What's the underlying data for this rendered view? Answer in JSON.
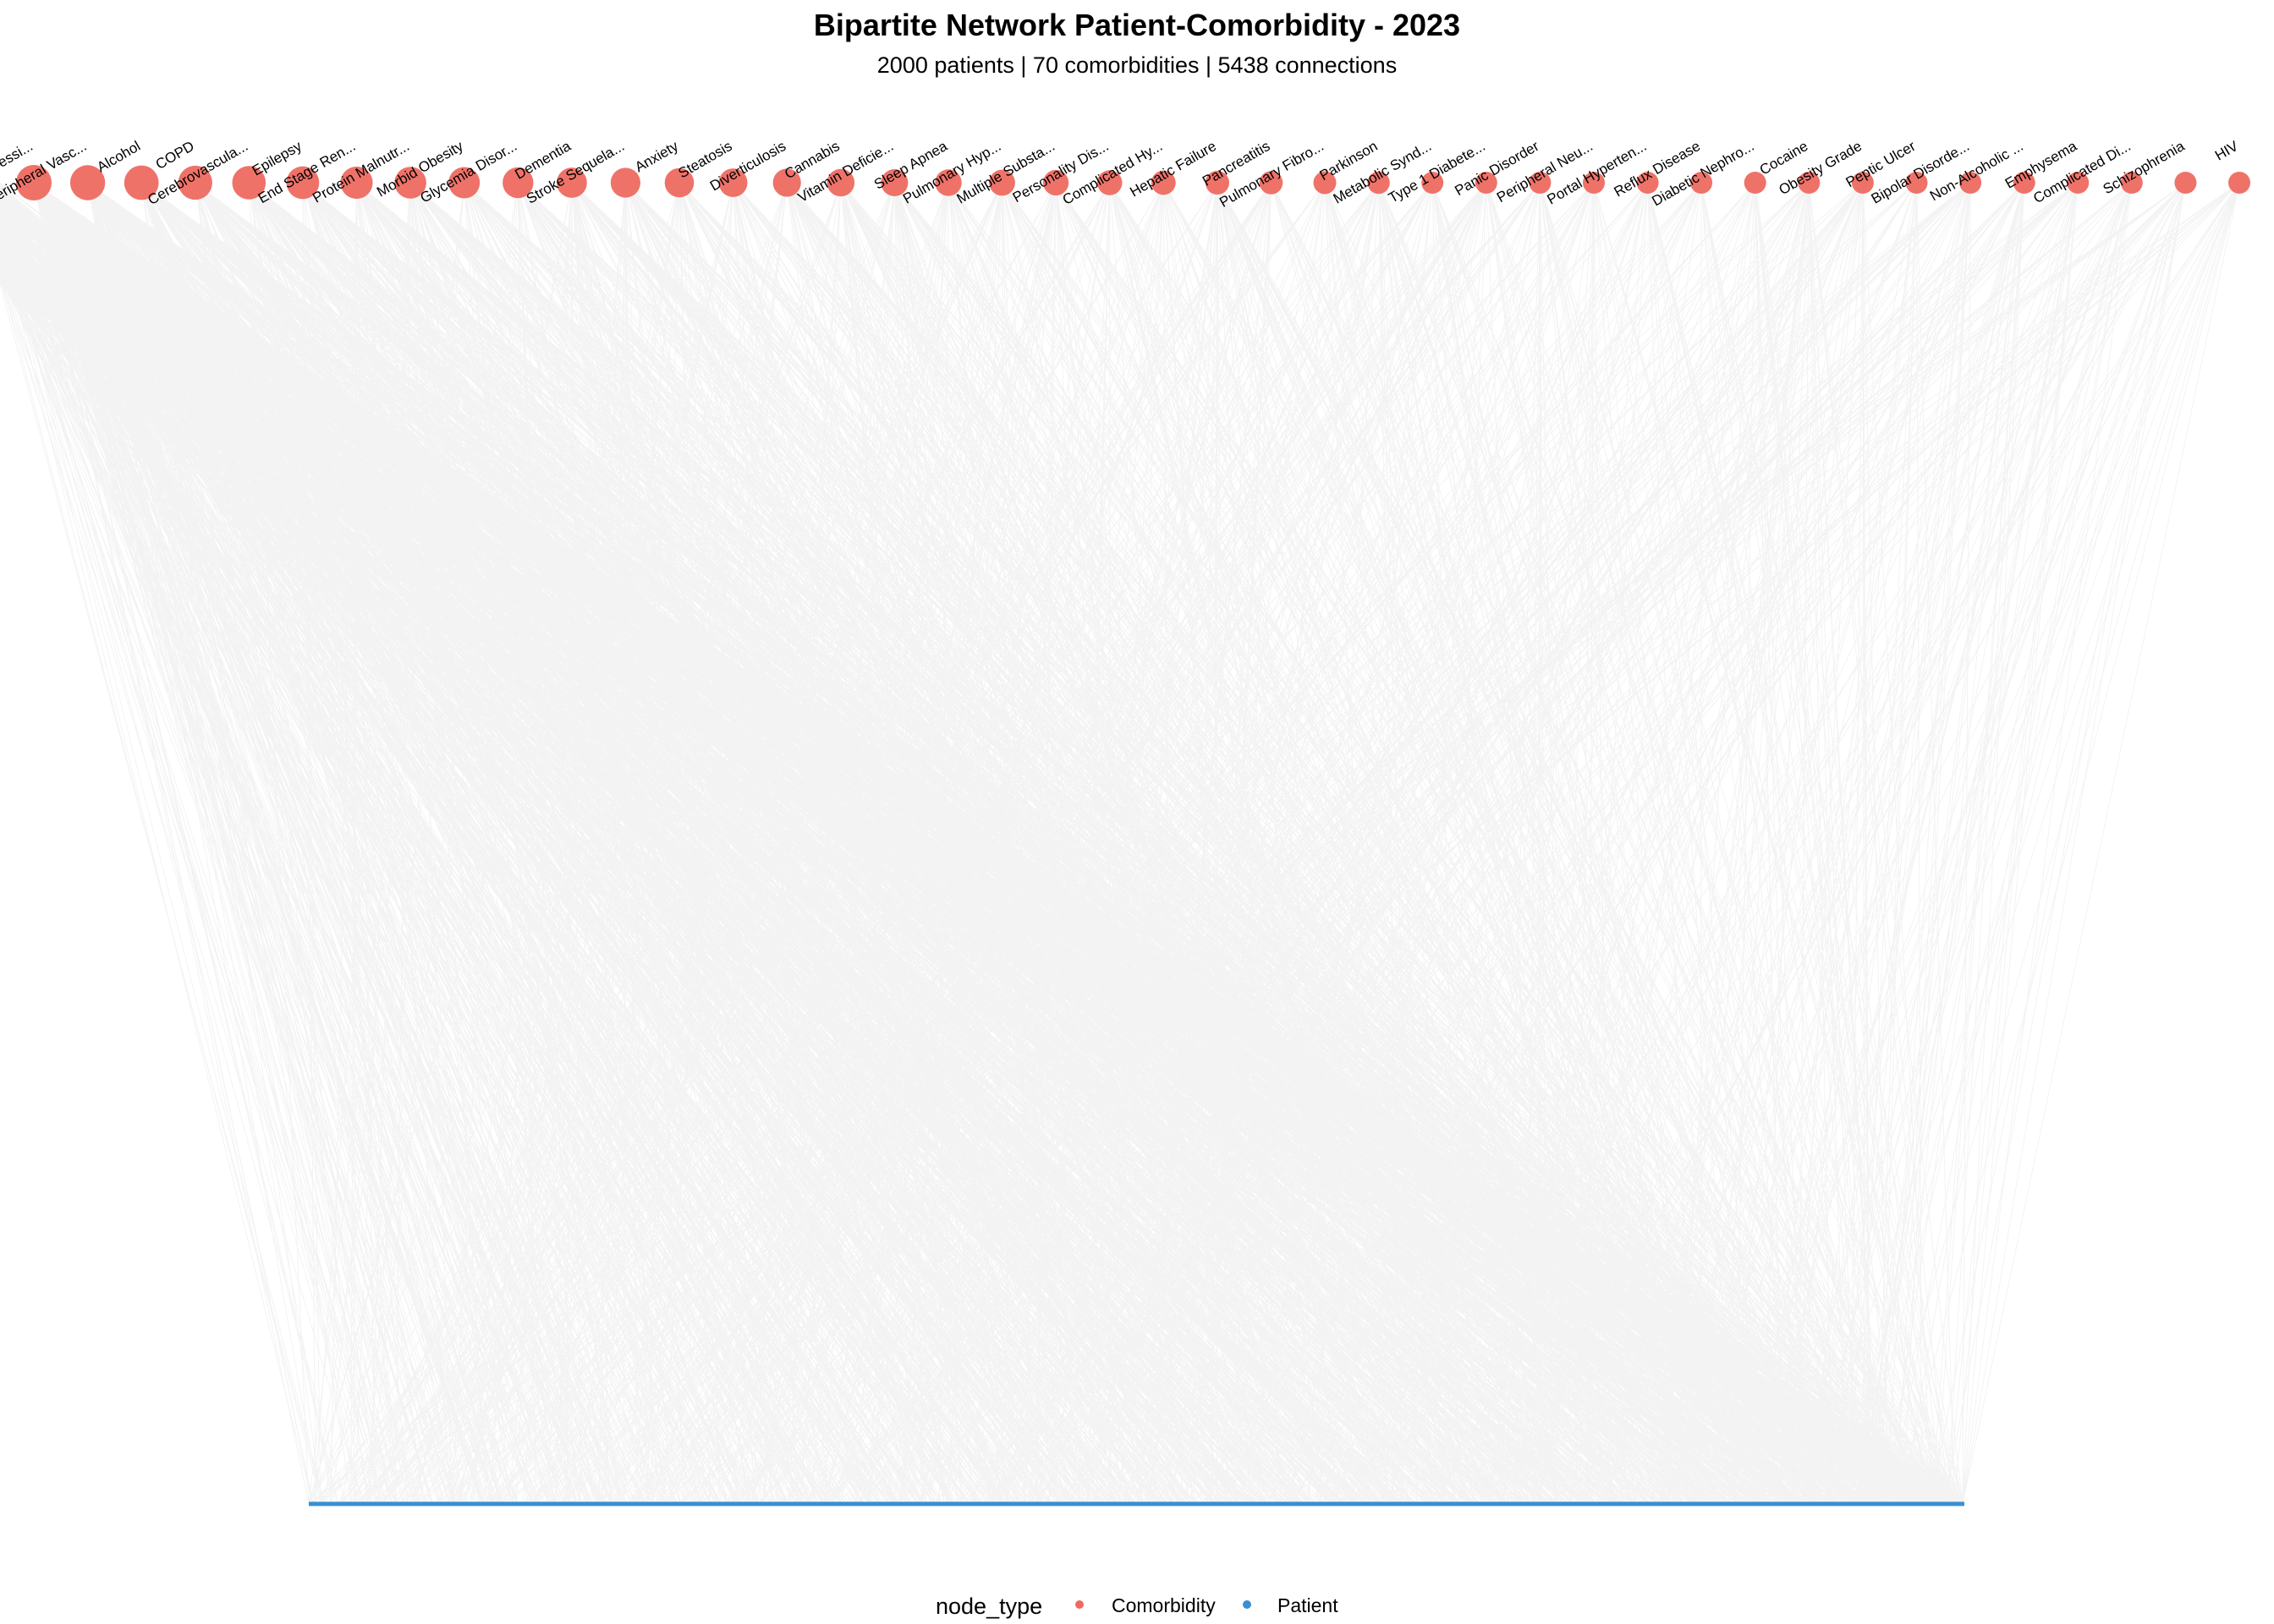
{
  "title": "Bipartite Network Patient-Comorbidity - 2023",
  "subtitle": "2000 patients | 70 comorbidities | 5438 connections",
  "legend": {
    "title": "node_type",
    "items": [
      {
        "label": "Comorbidity",
        "color": "#EE6A61"
      },
      {
        "label": "Patient",
        "color": "#3A8FD1"
      }
    ]
  },
  "colors": {
    "comorbidity": "#EE6A61",
    "patient": "#3A8FD1",
    "edge": "#c8c8c8"
  },
  "network": {
    "patients": 2000,
    "comorbidities_total": 70,
    "connections": 5438
  },
  "comorbidity_nodes": [
    {
      "label": "Major Depressi..."
    },
    {
      "label": "Peripheral Vasc..."
    },
    {
      "label": "Alcohol"
    },
    {
      "label": "COPD"
    },
    {
      "label": "Cerebrovascula..."
    },
    {
      "label": "Epilepsy"
    },
    {
      "label": "End Stage Ren..."
    },
    {
      "label": "Protein Malnutr..."
    },
    {
      "label": "Morbid Obesity"
    },
    {
      "label": "Glycemia Disor..."
    },
    {
      "label": "Dementia"
    },
    {
      "label": "Stroke Sequela..."
    },
    {
      "label": "Anxiety"
    },
    {
      "label": "Steatosis"
    },
    {
      "label": "Diverticulosis"
    },
    {
      "label": "Cannabis"
    },
    {
      "label": "Vitamin Deficie..."
    },
    {
      "label": "Sleep Apnea"
    },
    {
      "label": "Pulmonary Hyp..."
    },
    {
      "label": "Multiple Substa..."
    },
    {
      "label": "Personality Dis..."
    },
    {
      "label": "Complicated Hy..."
    },
    {
      "label": "Hepatic Failure"
    },
    {
      "label": "Pancreatitis"
    },
    {
      "label": "Pulmonary Fibro..."
    },
    {
      "label": "Parkinson"
    },
    {
      "label": "Metabolic Synd..."
    },
    {
      "label": "Type 1 Diabete..."
    },
    {
      "label": "Panic Disorder"
    },
    {
      "label": "Peripheral Neu..."
    },
    {
      "label": "Portal Hyperten..."
    },
    {
      "label": "Reflux Disease"
    },
    {
      "label": "Diabetic Nephro..."
    },
    {
      "label": "Cocaine"
    },
    {
      "label": "Obesity Grade"
    },
    {
      "label": "Peptic Ulcer"
    },
    {
      "label": "Bipolar Disorde..."
    },
    {
      "label": "Non-Alcoholic ..."
    },
    {
      "label": "Emphysema"
    },
    {
      "label": "Complicated Di..."
    },
    {
      "label": "Schizophrenia"
    },
    {
      "label": "HIV"
    }
  ]
}
